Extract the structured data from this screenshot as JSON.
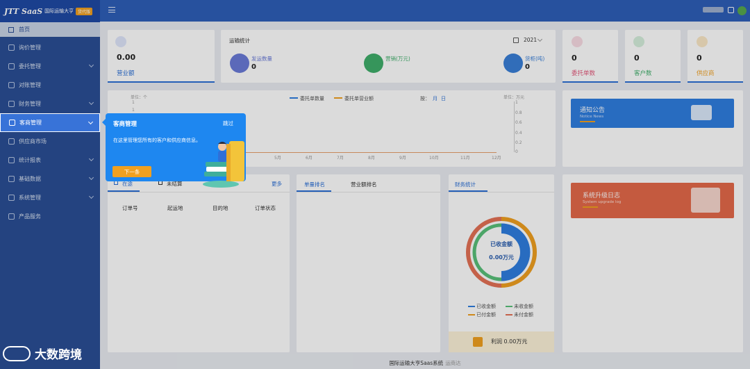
{
  "app": {
    "brand": "JTT SaaS",
    "subtitle": "国际运输大亨",
    "badge": "货代版"
  },
  "sidebar": {
    "home": "首页",
    "items": [
      {
        "label": "询价管理",
        "icon": "quote-icon",
        "chevron": false
      },
      {
        "label": "委托管理",
        "icon": "order-icon",
        "chevron": true
      },
      {
        "label": "对账管理",
        "icon": "check-icon",
        "chevron": false
      },
      {
        "label": "财务管理",
        "icon": "finance-icon",
        "chevron": true
      },
      {
        "label": "客商管理",
        "icon": "users-icon",
        "chevron": true,
        "active": true
      },
      {
        "label": "供应商市场",
        "icon": "market-icon",
        "chevron": false
      },
      {
        "label": "统计报表",
        "icon": "chart-icon",
        "chevron": true
      },
      {
        "label": "基础数据",
        "icon": "database-icon",
        "chevron": true
      },
      {
        "label": "系统管理",
        "icon": "gear-icon",
        "chevron": true
      },
      {
        "label": "产品服务",
        "icon": "service-icon",
        "chevron": false
      }
    ]
  },
  "revenue": {
    "value": "0.00",
    "label": "营业额"
  },
  "transport": {
    "title": "运输统计",
    "year": "2021",
    "items": [
      {
        "label": "发运数量",
        "value": "0",
        "color": "#6a7bd8"
      },
      {
        "label": "营销(万元)",
        "value": "",
        "color": "#3fae6a"
      },
      {
        "label": "货柜(吨)",
        "value": "0",
        "color": "#3a7fd8"
      }
    ]
  },
  "stats": [
    {
      "value": "0",
      "label": "委托单数",
      "color": "#e3577a"
    },
    {
      "value": "0",
      "label": "客户数",
      "color": "#3fae6a"
    },
    {
      "value": "0",
      "label": "供应商",
      "color": "#f0a020"
    }
  ],
  "chart": {
    "legend": [
      "委托单数量",
      "委托单营业额"
    ],
    "units": [
      "单位：个",
      "单位：万元"
    ],
    "toggle_label": "按：",
    "toggle": [
      "月",
      "日"
    ],
    "y_left": [
      "1",
      "1"
    ],
    "y_right": [
      "1",
      "0.8",
      "0.6",
      "0.4",
      "0.2",
      "0"
    ],
    "months": [
      "5月",
      "6月",
      "7月",
      "8月",
      "9月",
      "10月",
      "11月",
      "12月"
    ]
  },
  "orders": {
    "tabs": [
      "在途",
      "未结算"
    ],
    "more": "更多",
    "columns": [
      "订单号",
      "起运地",
      "目的地",
      "订单状态"
    ]
  },
  "ranking": {
    "tabs": [
      "单量排名",
      "营业额排名"
    ]
  },
  "finance": {
    "tab": "财务统计",
    "center_label": "已收金额",
    "center_value": "0.00万元",
    "legend": [
      "已收金额",
      "未收金额",
      "已付金额",
      "未付金额"
    ],
    "legend_colors": [
      "#2f7ee0",
      "#59c07a",
      "#f0a020",
      "#e57255"
    ],
    "profit": "利润 0.00万元"
  },
  "notice": {
    "title": "通知公告",
    "subtitle": "Notice News"
  },
  "upgrade": {
    "title": "系统升级日志",
    "subtitle": "System upgrade log"
  },
  "tour": {
    "title": "客商管理",
    "skip": "跳过",
    "body": "在这里管理您所有的客户和供应商信息。",
    "next": "下一条"
  },
  "footer": {
    "text": "国际运输大亨Saas系统",
    "highlight": "运商达"
  },
  "watermark": {
    "text": "大数跨境"
  }
}
